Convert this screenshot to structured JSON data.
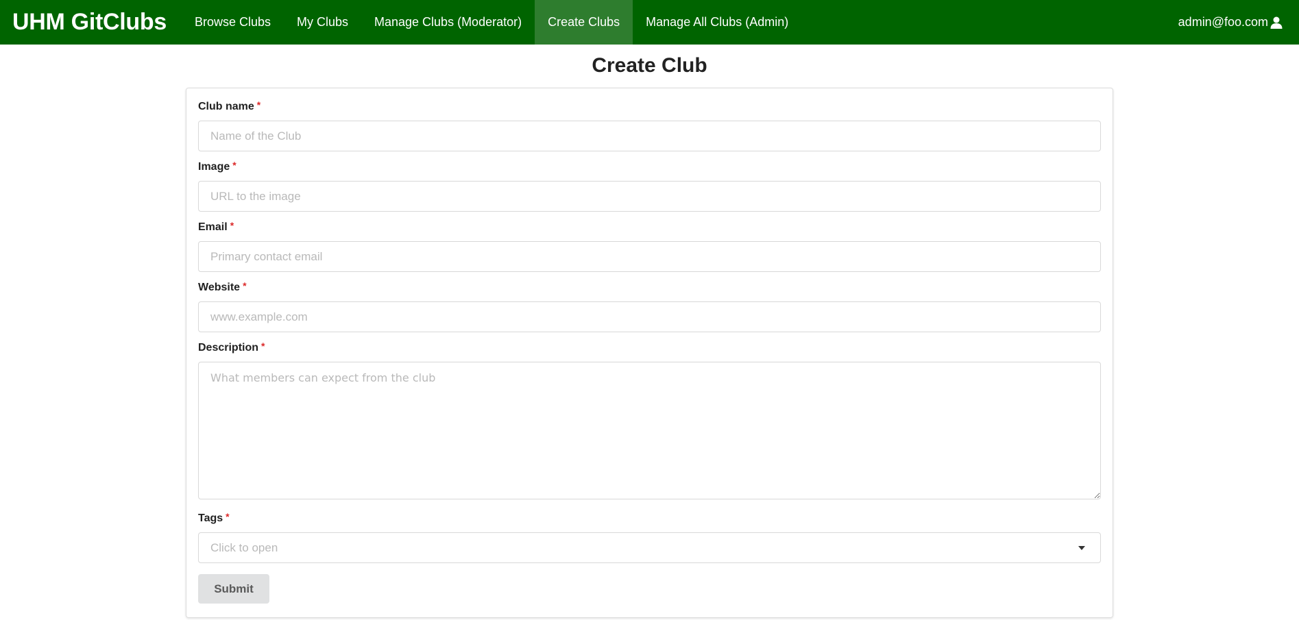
{
  "navbar": {
    "brand": "UHM GitClubs",
    "items": [
      {
        "label": "Browse Clubs"
      },
      {
        "label": "My Clubs"
      },
      {
        "label": "Manage Clubs (Moderator)"
      },
      {
        "label": "Create Clubs"
      },
      {
        "label": "Manage All Clubs (Admin)"
      }
    ],
    "active_index": 3,
    "user_email": "admin@foo.com",
    "user_icon": "user-icon",
    "colors": {
      "background": "#006400",
      "active": "#2e7d2e"
    }
  },
  "page": {
    "title": "Create Club"
  },
  "form": {
    "required_mark": "*",
    "club_name": {
      "label": "Club name",
      "placeholder": "Name of the Club",
      "value": ""
    },
    "image": {
      "label": "Image",
      "placeholder": "URL to the image",
      "value": ""
    },
    "email": {
      "label": "Email",
      "placeholder": "Primary contact email",
      "value": ""
    },
    "website": {
      "label": "Website",
      "placeholder": "www.example.com",
      "value": ""
    },
    "description": {
      "label": "Description",
      "placeholder": "What members can expect from the club",
      "value": ""
    },
    "tags": {
      "label": "Tags",
      "placeholder": "Click to open",
      "icon": "dropdown-caret-icon"
    },
    "submit_label": "Submit"
  }
}
